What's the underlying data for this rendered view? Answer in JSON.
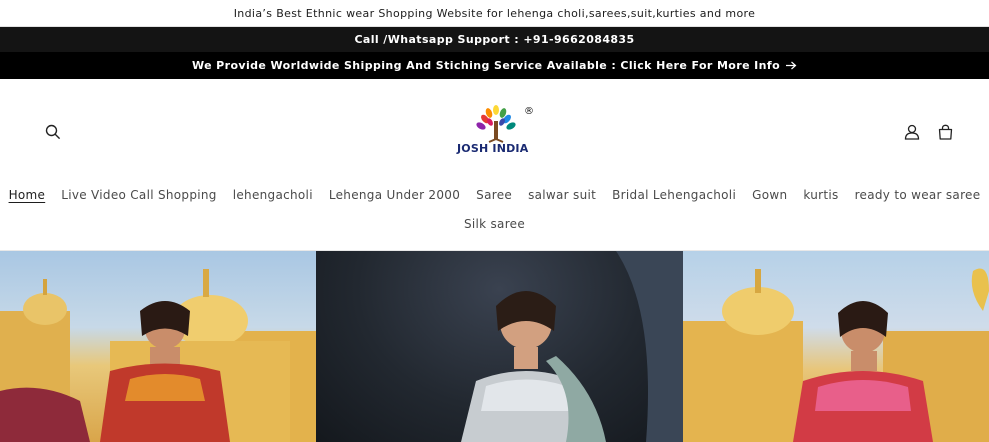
{
  "announcement": {
    "text": "India’s Best Ethnic wear Shopping Website for lehenga choli,sarees,suit,kurties and more"
  },
  "support": {
    "text": "Call /Whatsapp Support : +91-9662084835"
  },
  "shipping": {
    "text": "We Provide Worldwide Shipping And Stiching Service Available : Click Here For More Info",
    "icon": "arrow-right-icon"
  },
  "header": {
    "logo_text": "JOSH INDIA",
    "logo_mark": "®",
    "icons": {
      "search": "search-icon",
      "account": "account-icon",
      "cart": "cart-icon"
    }
  },
  "nav": {
    "row1": [
      {
        "label": "Home",
        "active": true
      },
      {
        "label": "Live Video Call Shopping"
      },
      {
        "label": "lehengacholi"
      },
      {
        "label": "Lehenga Under 2000"
      },
      {
        "label": "Saree"
      },
      {
        "label": "salwar suit"
      },
      {
        "label": "Bridal Lehengacholi"
      },
      {
        "label": "Gown"
      },
      {
        "label": "kurtis"
      },
      {
        "label": "ready to wear saree"
      }
    ],
    "row2": [
      {
        "label": "Silk saree"
      }
    ]
  },
  "hero": {
    "panels": [
      "banner-left",
      "banner-center",
      "banner-right"
    ]
  }
}
